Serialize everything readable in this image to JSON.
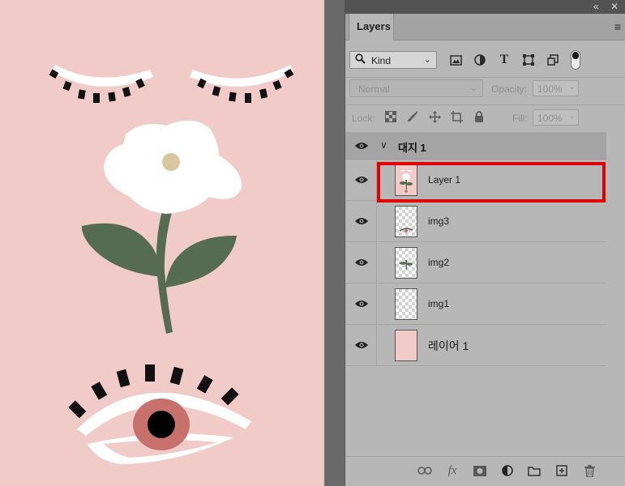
{
  "panel": {
    "tab_label": "Layers",
    "filter_kind": "Kind",
    "blend_mode": "Normal",
    "opacity_label": "Opacity:",
    "opacity_value": "100%",
    "lock_label": "Lock:",
    "fill_label": "Fill:",
    "fill_value": "100%"
  },
  "layers": {
    "group_name": "대지 1",
    "items": [
      {
        "name": "Layer 1",
        "selected": true
      },
      {
        "name": "img3"
      },
      {
        "name": "img2"
      },
      {
        "name": "img1"
      },
      {
        "name": "레이어 1"
      }
    ]
  },
  "icons": {
    "collapse": "double-chevron-left-icon",
    "close": "close-icon",
    "panel_menu": "hamburger-menu-icon",
    "search": "search-icon",
    "filter_pixel": "image-icon",
    "filter_adjustment": "half-circle-icon",
    "filter_type": "type-t-icon",
    "filter_shape": "shape-icon",
    "filter_smart": "smart-object-icon",
    "lock_transparent": "checkerboard-icon",
    "lock_pixels": "brush-icon",
    "lock_position": "move-icon",
    "lock_artboard": "artboard-icon",
    "lock_all": "lock-icon",
    "visibility": "eye-icon",
    "link": "link-icon",
    "fx": "fx-icon",
    "mask": "mask-icon",
    "adjustment": "adjustment-layer-icon",
    "group": "folder-icon",
    "new_layer": "new-layer-icon",
    "delete": "trash-icon"
  },
  "colors": {
    "canvas_pink": "#f1cbc7",
    "leaf_green": "#566c52",
    "iris": "#c8716c",
    "selection_outline": "#e00000"
  }
}
